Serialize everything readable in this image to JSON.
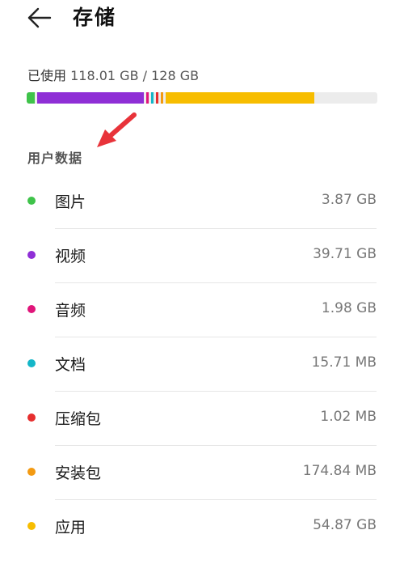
{
  "header": {
    "title": "存储"
  },
  "usage": {
    "label": "已使用",
    "value": "118.01 GB / 128 GB"
  },
  "storage_bar": {
    "total_gb": 128,
    "used_gb": 118.01,
    "segments": [
      {
        "category": "图片",
        "color": "#3fc34a",
        "gb": 3.87
      },
      {
        "category": "视频",
        "color": "#8f2fd6",
        "gb": 39.71
      },
      {
        "category": "音频",
        "color": "#e0157a",
        "gb": 1.98
      },
      {
        "category": "文档",
        "color": "#14b6c8",
        "gb": 0.0157
      },
      {
        "category": "压缩包",
        "color": "#e62e2e",
        "gb": 0.001
      },
      {
        "category": "安装包",
        "color": "#f39a12",
        "gb": 0.175
      },
      {
        "category": "应用",
        "color": "#f7bd00",
        "gb": 54.87
      }
    ]
  },
  "section": {
    "title": "用户数据"
  },
  "items": [
    {
      "name": "图片",
      "value": "3.87 GB",
      "color": "#3fc34a"
    },
    {
      "name": "视频",
      "value": "39.71 GB",
      "color": "#8f2fd6"
    },
    {
      "name": "音频",
      "value": "1.98 GB",
      "color": "#e0157a"
    },
    {
      "name": "文档",
      "value": "15.71 MB",
      "color": "#14b6c8"
    },
    {
      "name": "压缩包",
      "value": "1.02 MB",
      "color": "#e62e2e"
    },
    {
      "name": "安装包",
      "value": "174.84 MB",
      "color": "#f39a12"
    },
    {
      "name": "应用",
      "value": "54.87 GB",
      "color": "#f7bd00"
    }
  ],
  "icons": {
    "back": "back-arrow-icon",
    "annotation": "red-pointer-arrow-icon"
  },
  "colors": {
    "annotation_arrow": "#e8333a",
    "bar_track": "#ececec"
  }
}
